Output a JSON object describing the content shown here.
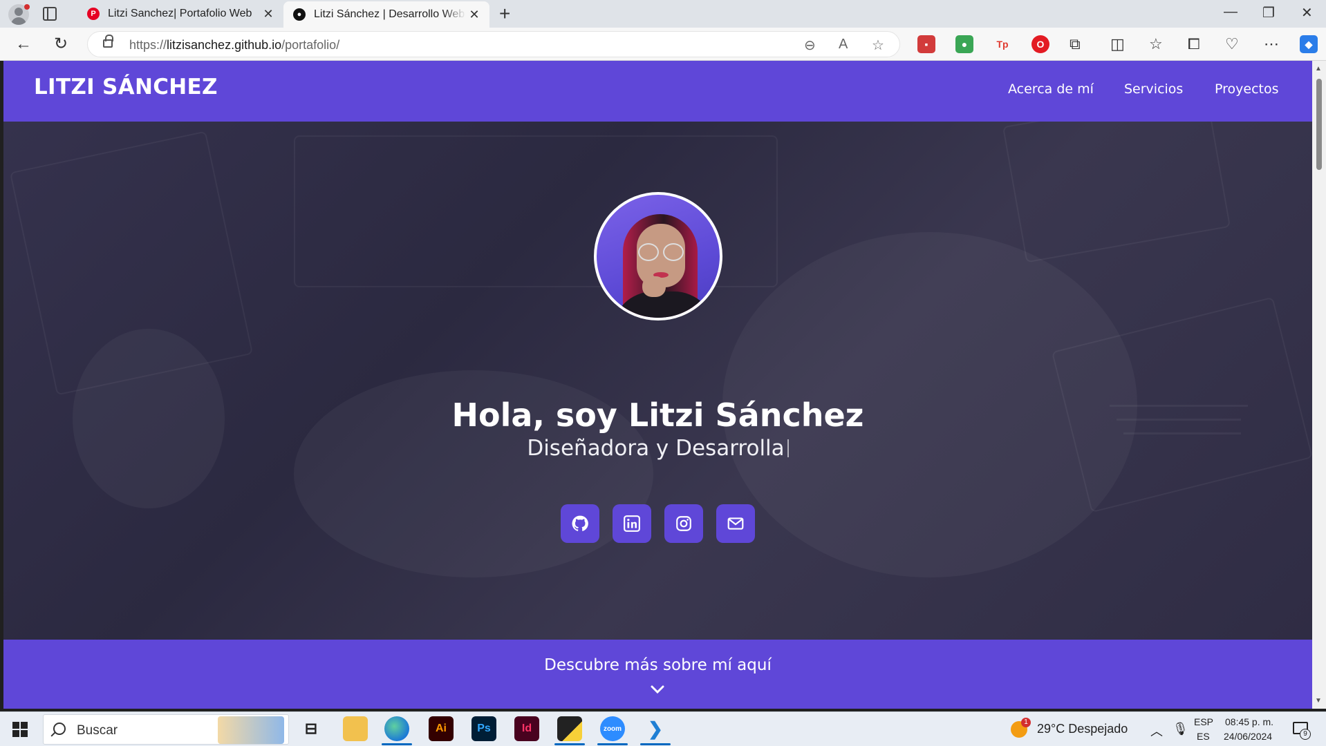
{
  "browser": {
    "tabs": [
      {
        "label": "Litzi Sanchez| Portafolio Web",
        "favicon": "pinterest-icon",
        "active": false
      },
      {
        "label": "Litzi Sánchez | Desarrollo Web Fr",
        "favicon": "github-icon",
        "active": true
      }
    ],
    "url_prefix": "https://",
    "url_host": "litzisanchez.github.io",
    "url_path": "/portafolio/"
  },
  "site": {
    "brand": "LITZI SÁNCHEZ",
    "nav": [
      {
        "label": "Acerca de mí"
      },
      {
        "label": "Servicios"
      },
      {
        "label": "Proyectos"
      }
    ],
    "hero": {
      "headline": "Hola, soy Litzi Sánchez",
      "subtitle": "Diseñadora y Desarrolla",
      "socials": [
        {
          "icon": "github-icon"
        },
        {
          "icon": "linkedin-icon"
        },
        {
          "icon": "instagram-icon"
        },
        {
          "icon": "mail-icon"
        }
      ]
    },
    "cta": "Descubre más sobre mí aquí",
    "colors": {
      "primary": "#5f47d8",
      "hero_overlay": "#2b2940"
    }
  },
  "taskbar": {
    "search_placeholder": "Buscar",
    "apps": [
      {
        "icon": "task-view-icon"
      },
      {
        "icon": "file-explorer-icon"
      },
      {
        "icon": "edge-icon",
        "label": ""
      },
      {
        "icon": "illustrator-icon",
        "label": "Ai"
      },
      {
        "icon": "photoshop-icon",
        "label": "Ps"
      },
      {
        "icon": "indesign-icon",
        "label": "Id"
      },
      {
        "icon": "sticky-notes-icon"
      },
      {
        "icon": "zoom-icon",
        "label": "zoom"
      },
      {
        "icon": "vscode-icon"
      }
    ],
    "weather": {
      "badge": "1",
      "text": "29°C  Despejado"
    },
    "language": {
      "line1": "ESP",
      "line2": "ES"
    },
    "clock": {
      "time": "08:45 p. m.",
      "date": "24/06/2024"
    },
    "notification_count": "9"
  }
}
